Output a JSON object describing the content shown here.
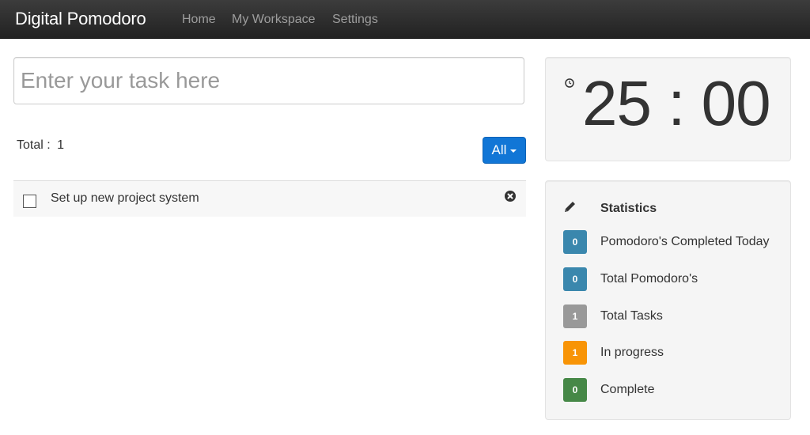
{
  "nav": {
    "brand": "Digital Pomodoro",
    "links": [
      "Home",
      "My Workspace",
      "Settings"
    ]
  },
  "task_input": {
    "placeholder": "Enter your task here",
    "value": ""
  },
  "summary": {
    "total_label": "Total :",
    "total_value": "1"
  },
  "filter": {
    "label": "All",
    "icon": "caret-down-icon"
  },
  "tasks": [
    {
      "label": "Set up new project system",
      "checked": false,
      "remove_icon": "remove-circle-icon"
    }
  ],
  "timer": {
    "icon": "clock-icon",
    "display": "25 : 00"
  },
  "statistics": {
    "icon": "pencil-icon",
    "title": "Statistics",
    "items": [
      {
        "value": "0",
        "label": "Pomodoro's Completed Today",
        "color": "#3a87ad"
      },
      {
        "value": "0",
        "label": "Total Pomodoro's",
        "color": "#3a87ad"
      },
      {
        "value": "1",
        "label": "Total Tasks",
        "color": "#999999"
      },
      {
        "value": "1",
        "label": "In progress",
        "color": "#f89406"
      },
      {
        "value": "0",
        "label": "Complete",
        "color": "#468847"
      }
    ]
  },
  "colors": {
    "navbar": "#222222",
    "primary": "#1176d6",
    "panel": "#f5f5f5"
  }
}
